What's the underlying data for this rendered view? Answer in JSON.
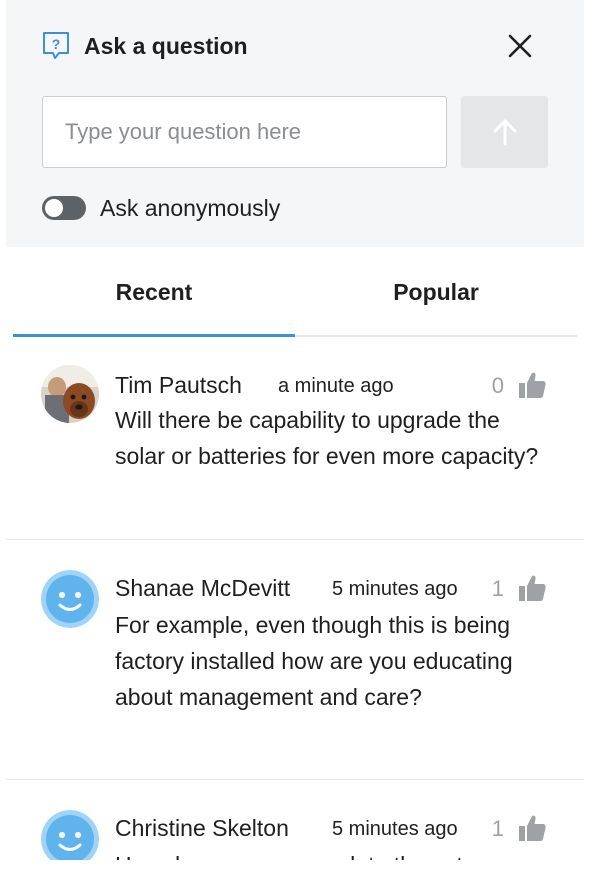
{
  "header": {
    "title": "Ask a question",
    "icon": "question-bubble-icon",
    "close_icon": "close-icon"
  },
  "ask": {
    "placeholder": "Type your question here",
    "value": "",
    "submit_icon": "arrow-up-icon",
    "anonymous_label": "Ask anonymously",
    "anonymous_enabled": false
  },
  "tabs": [
    {
      "label": "Recent",
      "active": true
    },
    {
      "label": "Popular",
      "active": false
    }
  ],
  "questions": [
    {
      "author": "Tim Pautsch",
      "time": "a minute ago",
      "likes": "0",
      "avatar": "photo-avatar",
      "text": "Will there be capability to upgrade the solar or batteries for even more capacity?"
    },
    {
      "author": "Shanae McDevitt",
      "time": "5 minutes ago",
      "likes": "1",
      "avatar": "smiley-avatar",
      "text": "For example, even though this is being factory installed how are you educating about management and care?"
    },
    {
      "author": "Christine Skelton",
      "time": "5 minutes ago",
      "likes": "1",
      "avatar": "smiley-avatar",
      "text": "How do you accommodate the extra"
    }
  ],
  "colors": {
    "accent": "#3d8fd6",
    "avatar_ring": "#9fd3f7",
    "avatar_fill": "#5fb4ee",
    "muted": "#9ea2a6"
  }
}
